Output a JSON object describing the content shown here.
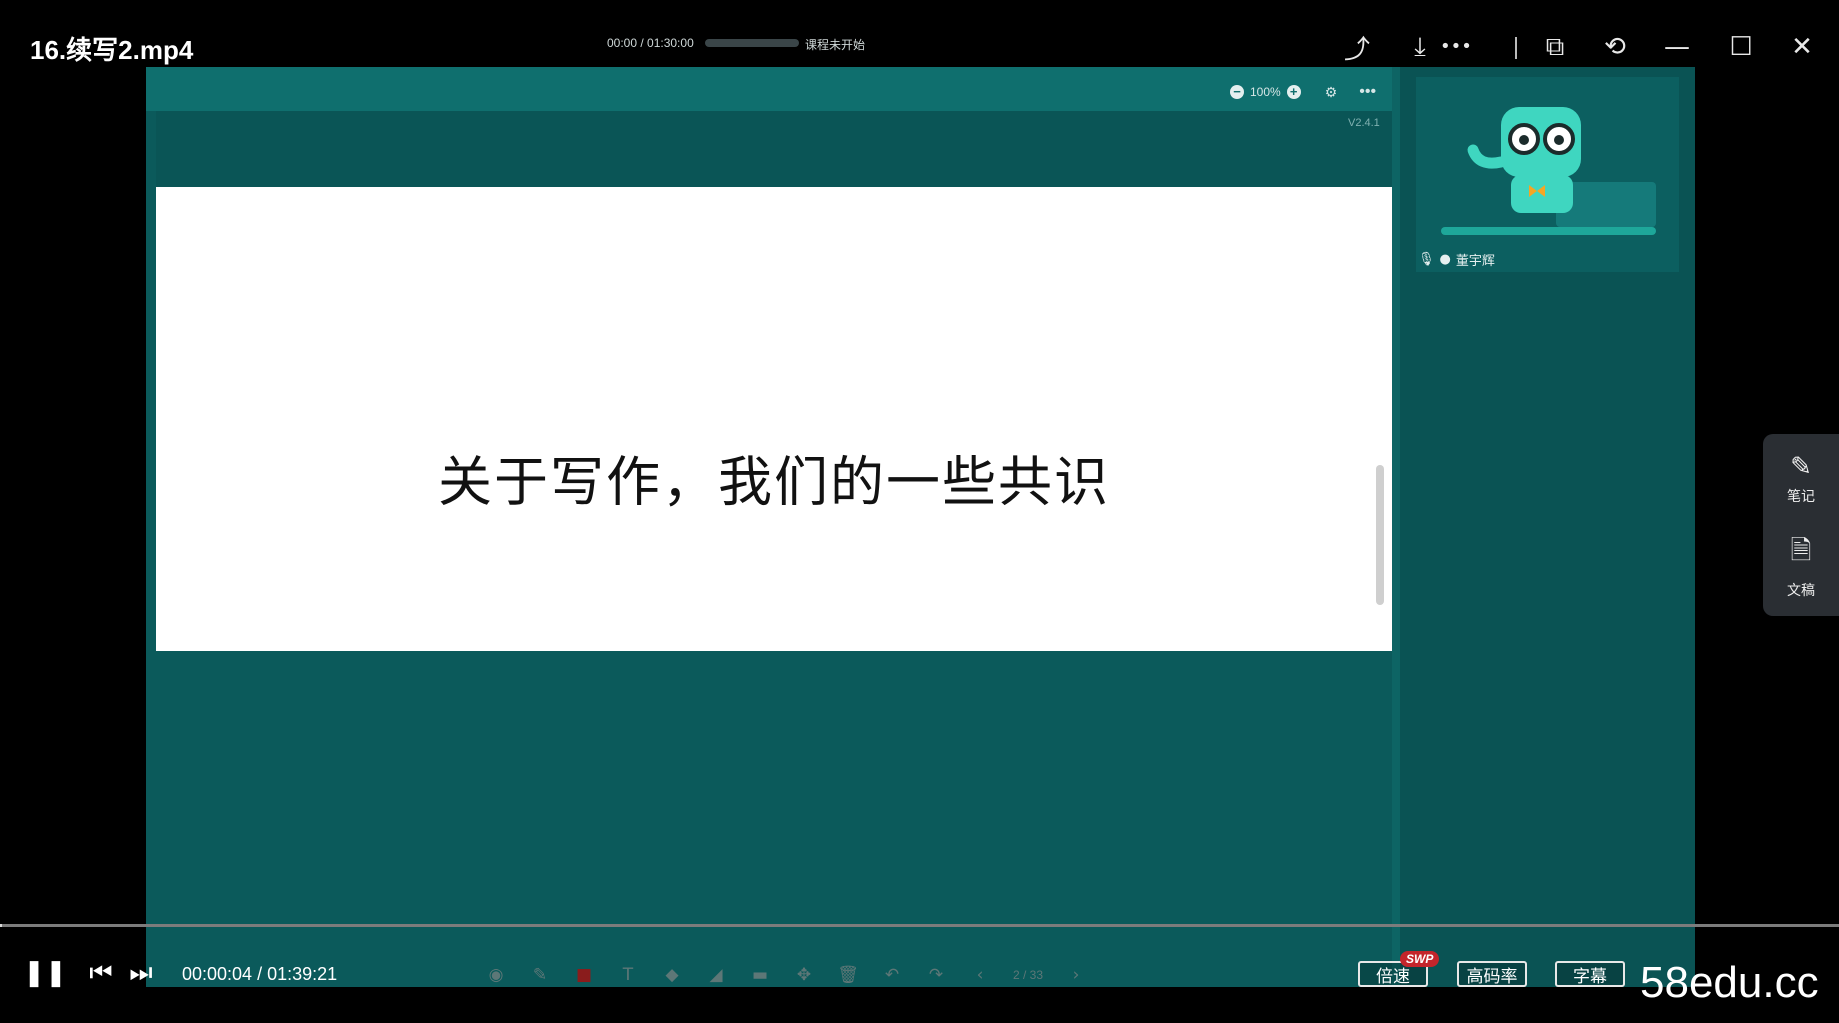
{
  "window": {
    "title": "16.续写2.mp4",
    "share_icon": "share-icon",
    "download_icon": "download-icon",
    "pip_icon": "picture-in-picture-icon",
    "rotate_icon": "rotate-icon",
    "minimize_icon": "minimize-icon",
    "maximize_icon": "maximize-icon",
    "close_icon": "close-icon"
  },
  "embedded_app": {
    "mini_time": "00:00 / 01:30:00",
    "mini_status": "课程未开始",
    "zoom_level": "100%",
    "version": "V2.4.1",
    "slide_text": "关于写作，我们的一些共识",
    "teacher_name": "董宇辉",
    "toolbar_page": "2 / 33",
    "colors": {
      "background": "#0b5a5b",
      "topbar": "#0f6f6e",
      "slide": "#ffffff"
    }
  },
  "side_panel": {
    "notes_label": "笔记",
    "transcript_label": "文稿"
  },
  "player": {
    "time": "00:00:04 / 01:39:21",
    "speed_label": "倍速",
    "swp_badge": "SWP",
    "bitrate_label": "高码率",
    "subtitle_label": "字幕",
    "watermark": "58edu.cc"
  }
}
